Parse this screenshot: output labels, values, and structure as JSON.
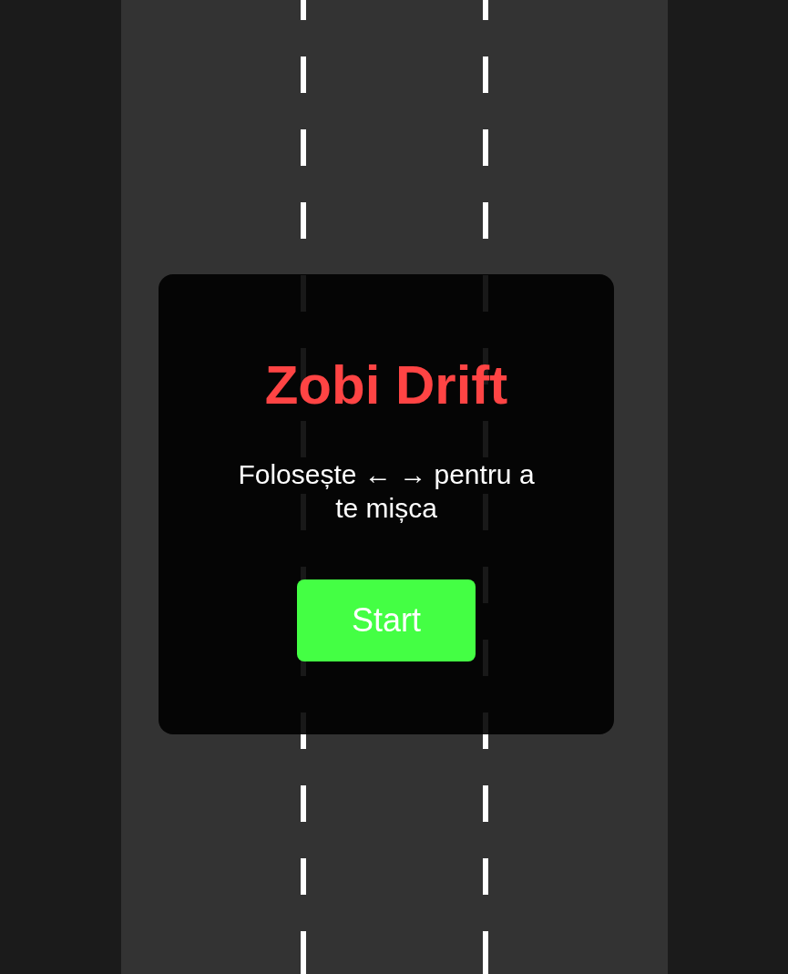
{
  "title": "Zobi Drift",
  "instructions": "Folosește ← → pentru a te mișca",
  "start_button": "Start"
}
